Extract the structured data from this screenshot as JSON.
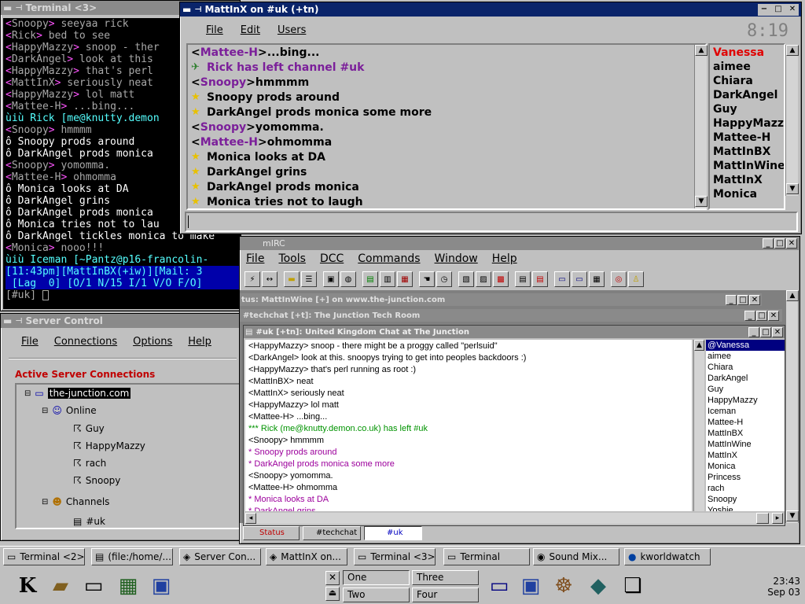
{
  "terminal3": {
    "title": "Terminal <3>",
    "lines": [
      {
        "nick": "Snoopy",
        "text": " seeyaa rick",
        "kind": "msg"
      },
      {
        "nick": "Rick",
        "text": " bed to see",
        "kind": "msg"
      },
      {
        "nick": "HappyMazzy",
        "text": " snoop - ther",
        "kind": "msg"
      },
      {
        "nick": "DarkAngel",
        "text": " look at this",
        "kind": "msg"
      },
      {
        "nick": "HappyMazzy",
        "text": " that's perl",
        "kind": "msg"
      },
      {
        "nick": "MattInX",
        "text": " seriously neat",
        "kind": "msg"
      },
      {
        "nick": "HappyMazzy",
        "text": " lol matt",
        "kind": "msg"
      },
      {
        "nick": "Mattee-H",
        "text": " ...bing...",
        "kind": "msg"
      },
      {
        "nick": "",
        "text": "ùiù Rick [me@knutty.demon",
        "kind": "sys"
      },
      {
        "nick": "Snoopy",
        "text": " hmmmm",
        "kind": "msg"
      },
      {
        "nick": "",
        "text": "ô Snoopy prods around",
        "kind": "act"
      },
      {
        "nick": "",
        "text": "ô DarkAngel prods monica",
        "kind": "act"
      },
      {
        "nick": "Snoopy",
        "text": " yomomma.",
        "kind": "msg"
      },
      {
        "nick": "Mattee-H",
        "text": " ohmomma",
        "kind": "msg"
      },
      {
        "nick": "",
        "text": "ô Monica looks at DA",
        "kind": "act"
      },
      {
        "nick": "",
        "text": "ô DarkAngel grins",
        "kind": "act"
      },
      {
        "nick": "",
        "text": "ô DarkAngel prods monica",
        "kind": "act"
      },
      {
        "nick": "",
        "text": "ô Monica tries not to lau",
        "kind": "act"
      },
      {
        "nick": "",
        "text": "ô DarkAngel tickles monica to make",
        "kind": "act"
      },
      {
        "nick": "Monica",
        "text": " nooo!!!",
        "kind": "msg"
      },
      {
        "nick": "",
        "text": "ùiù Iceman [~Pantz@p16-francolin-",
        "kind": "sys"
      }
    ],
    "status1": "[11:43pm][MattInBX(+iw)][Mail: 3",
    "status2": " [Lag  0] [O/1 N/15 I/1 V/O F/O]",
    "prompt": "[#uk] "
  },
  "kvirc": {
    "title": "MattInX on #uk (+tn)",
    "menu": [
      "File",
      "Edit",
      "Users"
    ],
    "clock": "8:19",
    "lines": [
      {
        "type": "msg",
        "nick": "Mattee-H",
        "text": " ...bing..."
      },
      {
        "type": "part",
        "text": "Rick has left channel #uk"
      },
      {
        "type": "msg",
        "nick": "Snoopy",
        "text": " hmmmm"
      },
      {
        "type": "act",
        "text": "Snoopy prods around"
      },
      {
        "type": "act",
        "text": "DarkAngel prods monica some more"
      },
      {
        "type": "msg",
        "nick": "Snoopy",
        "text": " yomomma."
      },
      {
        "type": "msg",
        "nick": "Mattee-H",
        "text": " ohmomma"
      },
      {
        "type": "act",
        "text": "Monica looks at DA"
      },
      {
        "type": "act",
        "text": "DarkAngel grins"
      },
      {
        "type": "act",
        "text": "DarkAngel prods monica"
      },
      {
        "type": "act",
        "text": "Monica tries not to laugh"
      }
    ],
    "nicks": [
      "Vanessa",
      "aimee",
      "Chiara",
      "DarkAngel",
      "Guy",
      "HappyMazzy",
      "Mattee-H",
      "MattInBX",
      "MattInWine",
      "MattInX",
      "Monica"
    ]
  },
  "server": {
    "title": "Server Control",
    "menu": [
      "File",
      "Connections",
      "Options",
      "Help"
    ],
    "heading": "Active Server Connections",
    "tree": {
      "server": "the-junction.com",
      "online": "Online",
      "users": [
        "Guy",
        "HappyMazzy",
        "rach",
        "Snoopy"
      ],
      "channels": "Channels",
      "channel": "#uk"
    }
  },
  "mirc": {
    "title": "mIRC",
    "menu": [
      "File",
      "Tools",
      "DCC",
      "Commands",
      "Window",
      "Help"
    ],
    "status_title": "tus: MattInWine [+] on www.the-junction.com",
    "techchat_title": "#techchat [+t]: The Junction Tech Room",
    "uk_title": "#uk [+tn]: United Kingdom Chat at The Junction",
    "lines": [
      {
        "t": "<HappyMazzy> snoop - there might be a proggy called \"perlsuid\"",
        "k": "msg"
      },
      {
        "t": "<DarkAngel> look at this. snoopys trying to get into peoples backdoors :)",
        "k": "msg"
      },
      {
        "t": "<HappyMazzy> that's perl running as root :)",
        "k": "msg"
      },
      {
        "t": "<MattInBX> neat",
        "k": "msg"
      },
      {
        "t": "<MattInX> seriously neat",
        "k": "msg"
      },
      {
        "t": "<HappyMazzy> lol matt",
        "k": "msg"
      },
      {
        "t": "<Mattee-H> ...bing...",
        "k": "msg"
      },
      {
        "t": "*** Rick (me@knutty.demon.co.uk) has left #uk",
        "k": "join"
      },
      {
        "t": "<Snoopy> hmmmm",
        "k": "msg"
      },
      {
        "t": "* Snoopy prods around",
        "k": "act"
      },
      {
        "t": "* DarkAngel prods monica some more",
        "k": "act"
      },
      {
        "t": "<Snoopy> yomomma.",
        "k": "msg"
      },
      {
        "t": "<Mattee-H> ohmomma",
        "k": "msg"
      },
      {
        "t": "* Monica looks at DA",
        "k": "act"
      },
      {
        "t": "* DarkAngel grins",
        "k": "act"
      }
    ],
    "nicks": [
      "@Vanessa",
      "aimee",
      "Chiara",
      "DarkAngel",
      "Guy",
      "HappyMazzy",
      "Iceman",
      "Mattee-H",
      "MattInBX",
      "MattInWine",
      "MattInX",
      "Monica",
      "Princess",
      "rach",
      "Snoopy",
      "Yoshie"
    ],
    "switchbar": [
      "Status",
      "#techchat",
      "#uk"
    ]
  },
  "taskbar": [
    "Terminal <2>",
    "(file:/home/...",
    "Server Con...",
    "MattInX on...",
    "Terminal <3>",
    "Terminal",
    "Sound Mix...",
    "kworldwatch"
  ],
  "desktops": [
    "One",
    "Three",
    "Two",
    "Four"
  ],
  "clock": {
    "time": "23:43",
    "date": "Sep 03"
  }
}
